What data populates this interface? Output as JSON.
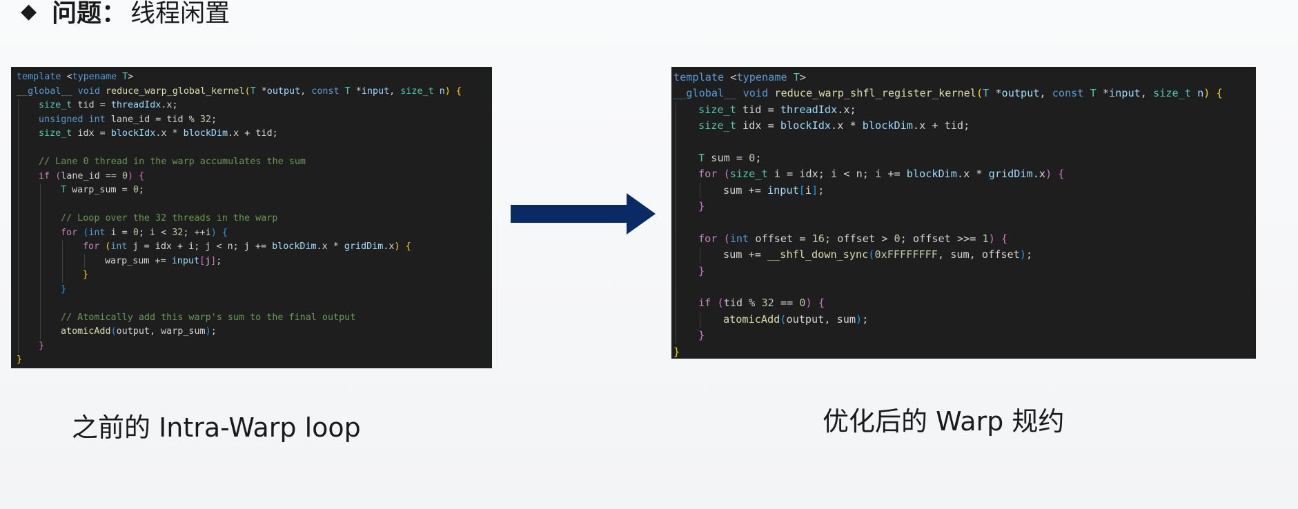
{
  "heading": {
    "bullet": "◆",
    "label": "问题：",
    "text": "线程闲置"
  },
  "colors": {
    "code_background": "#1e1e1e",
    "arrow": "#0a2a66",
    "keyword": "#569cd6",
    "control": "#c586c0",
    "type": "#4ec9b0",
    "function": "#dcdcaa",
    "variable": "#9cdcfe",
    "number": "#b5cea8",
    "comment": "#6a9955"
  },
  "code_left": {
    "lines": [
      {
        "indent": 0,
        "tokens": [
          [
            "kw",
            "template"
          ],
          [
            "plain",
            " <"
          ],
          [
            "kw",
            "typename"
          ],
          [
            "plain",
            " "
          ],
          [
            "ty",
            "T"
          ],
          [
            "plain",
            ">"
          ]
        ]
      },
      {
        "indent": 0,
        "tokens": [
          [
            "kw",
            "__global__"
          ],
          [
            "plain",
            " "
          ],
          [
            "kw",
            "void"
          ],
          [
            "plain",
            " "
          ],
          [
            "fn",
            "reduce_warp_global_kernel"
          ],
          [
            "br1",
            "("
          ],
          [
            "ty",
            "T"
          ],
          [
            "plain",
            " *"
          ],
          [
            "var",
            "output"
          ],
          [
            "plain",
            ", "
          ],
          [
            "kw",
            "const"
          ],
          [
            "plain",
            " "
          ],
          [
            "ty",
            "T"
          ],
          [
            "plain",
            " *"
          ],
          [
            "var",
            "input"
          ],
          [
            "plain",
            ", "
          ],
          [
            "ty",
            "size_t"
          ],
          [
            "plain",
            " "
          ],
          [
            "var",
            "n"
          ],
          [
            "br1",
            ")"
          ],
          [
            "plain",
            " "
          ],
          [
            "br1",
            "{"
          ]
        ]
      },
      {
        "indent": 1,
        "tokens": [
          [
            "ty",
            "size_t"
          ],
          [
            "plain",
            " tid = "
          ],
          [
            "var",
            "threadIdx"
          ],
          [
            "plain",
            ".x;"
          ]
        ]
      },
      {
        "indent": 1,
        "tokens": [
          [
            "kw",
            "unsigned int"
          ],
          [
            "plain",
            " lane_id = tid % "
          ],
          [
            "num",
            "32"
          ],
          [
            "plain",
            ";"
          ]
        ]
      },
      {
        "indent": 1,
        "tokens": [
          [
            "ty",
            "size_t"
          ],
          [
            "plain",
            " idx = "
          ],
          [
            "var",
            "blockIdx"
          ],
          [
            "plain",
            ".x * "
          ],
          [
            "var",
            "blockDim"
          ],
          [
            "plain",
            ".x + tid;"
          ]
        ]
      },
      {
        "indent": 1,
        "tokens": []
      },
      {
        "indent": 1,
        "tokens": [
          [
            "cm",
            "// Lane 0 thread in the warp accumulates the sum"
          ]
        ]
      },
      {
        "indent": 1,
        "tokens": [
          [
            "ctl",
            "if"
          ],
          [
            "plain",
            " "
          ],
          [
            "br2",
            "("
          ],
          [
            "plain",
            "lane_id == "
          ],
          [
            "num",
            "0"
          ],
          [
            "br2",
            ")"
          ],
          [
            "plain",
            " "
          ],
          [
            "br2",
            "{"
          ]
        ]
      },
      {
        "indent": 2,
        "tokens": [
          [
            "ty",
            "T"
          ],
          [
            "plain",
            " warp_sum = "
          ],
          [
            "num",
            "0"
          ],
          [
            "plain",
            ";"
          ]
        ]
      },
      {
        "indent": 2,
        "tokens": []
      },
      {
        "indent": 2,
        "tokens": [
          [
            "cm",
            "// Loop over the 32 threads in the warp"
          ]
        ]
      },
      {
        "indent": 2,
        "tokens": [
          [
            "ctl",
            "for"
          ],
          [
            "plain",
            " "
          ],
          [
            "br3",
            "("
          ],
          [
            "kw",
            "int"
          ],
          [
            "plain",
            " i = "
          ],
          [
            "num",
            "0"
          ],
          [
            "plain",
            "; i < "
          ],
          [
            "num",
            "32"
          ],
          [
            "plain",
            "; ++i"
          ],
          [
            "br3",
            ")"
          ],
          [
            "plain",
            " "
          ],
          [
            "br3",
            "{"
          ]
        ]
      },
      {
        "indent": 3,
        "tokens": [
          [
            "ctl",
            "for"
          ],
          [
            "plain",
            " "
          ],
          [
            "br1",
            "("
          ],
          [
            "kw",
            "int"
          ],
          [
            "plain",
            " j = idx + i; j < n; j += "
          ],
          [
            "var",
            "blockDim"
          ],
          [
            "plain",
            ".x * "
          ],
          [
            "var",
            "gridDim"
          ],
          [
            "plain",
            ".x"
          ],
          [
            "br1",
            ")"
          ],
          [
            "plain",
            " "
          ],
          [
            "br1",
            "{"
          ]
        ]
      },
      {
        "indent": 4,
        "tokens": [
          [
            "plain",
            "warp_sum += "
          ],
          [
            "var",
            "input"
          ],
          [
            "br2",
            "["
          ],
          [
            "plain",
            "j"
          ],
          [
            "br2",
            "]"
          ],
          [
            "plain",
            ";"
          ]
        ]
      },
      {
        "indent": 3,
        "tokens": [
          [
            "br1",
            "}"
          ]
        ]
      },
      {
        "indent": 2,
        "tokens": [
          [
            "br3",
            "}"
          ]
        ]
      },
      {
        "indent": 2,
        "tokens": []
      },
      {
        "indent": 2,
        "tokens": [
          [
            "cm",
            "// Atomically add this warp's sum to the final output"
          ]
        ]
      },
      {
        "indent": 2,
        "tokens": [
          [
            "fn",
            "atomicAdd"
          ],
          [
            "br3",
            "("
          ],
          [
            "plain",
            "output, warp_sum"
          ],
          [
            "br3",
            ")"
          ],
          [
            "plain",
            ";"
          ]
        ]
      },
      {
        "indent": 1,
        "tokens": [
          [
            "br2",
            "}"
          ]
        ]
      },
      {
        "indent": 0,
        "tokens": [
          [
            "br1",
            "}"
          ]
        ]
      }
    ]
  },
  "code_right": {
    "lines": [
      {
        "indent": 0,
        "tokens": [
          [
            "kw",
            "template"
          ],
          [
            "plain",
            " <"
          ],
          [
            "kw",
            "typename"
          ],
          [
            "plain",
            " "
          ],
          [
            "ty",
            "T"
          ],
          [
            "plain",
            ">"
          ]
        ]
      },
      {
        "indent": 0,
        "tokens": [
          [
            "kw",
            "__global__"
          ],
          [
            "plain",
            " "
          ],
          [
            "kw",
            "void"
          ],
          [
            "plain",
            " "
          ],
          [
            "fn",
            "reduce_warp_shfl_register_kernel"
          ],
          [
            "br1",
            "("
          ],
          [
            "ty",
            "T"
          ],
          [
            "plain",
            " *"
          ],
          [
            "var",
            "output"
          ],
          [
            "plain",
            ", "
          ],
          [
            "kw",
            "const"
          ],
          [
            "plain",
            " "
          ],
          [
            "ty",
            "T"
          ],
          [
            "plain",
            " *"
          ],
          [
            "var",
            "input"
          ],
          [
            "plain",
            ", "
          ],
          [
            "ty",
            "size_t"
          ],
          [
            "plain",
            " "
          ],
          [
            "var",
            "n"
          ],
          [
            "br1",
            ")"
          ],
          [
            "plain",
            " "
          ],
          [
            "br1",
            "{"
          ]
        ]
      },
      {
        "indent": 1,
        "tokens": [
          [
            "ty",
            "size_t"
          ],
          [
            "plain",
            " tid = "
          ],
          [
            "var",
            "threadIdx"
          ],
          [
            "plain",
            ".x;"
          ]
        ]
      },
      {
        "indent": 1,
        "tokens": [
          [
            "ty",
            "size_t"
          ],
          [
            "plain",
            " idx = "
          ],
          [
            "var",
            "blockIdx"
          ],
          [
            "plain",
            ".x * "
          ],
          [
            "var",
            "blockDim"
          ],
          [
            "plain",
            ".x + tid;"
          ]
        ]
      },
      {
        "indent": 1,
        "tokens": []
      },
      {
        "indent": 1,
        "tokens": [
          [
            "ty",
            "T"
          ],
          [
            "plain",
            " sum = "
          ],
          [
            "num",
            "0"
          ],
          [
            "plain",
            ";"
          ]
        ]
      },
      {
        "indent": 1,
        "tokens": [
          [
            "ctl",
            "for"
          ],
          [
            "plain",
            " "
          ],
          [
            "br2",
            "("
          ],
          [
            "ty",
            "size_t"
          ],
          [
            "plain",
            " i = idx; i < n; i += "
          ],
          [
            "var",
            "blockDim"
          ],
          [
            "plain",
            ".x * "
          ],
          [
            "var",
            "gridDim"
          ],
          [
            "plain",
            ".x"
          ],
          [
            "br2",
            ")"
          ],
          [
            "plain",
            " "
          ],
          [
            "br2",
            "{"
          ]
        ]
      },
      {
        "indent": 2,
        "tokens": [
          [
            "plain",
            "sum += "
          ],
          [
            "var",
            "input"
          ],
          [
            "br3",
            "["
          ],
          [
            "plain",
            "i"
          ],
          [
            "br3",
            "]"
          ],
          [
            "plain",
            ";"
          ]
        ]
      },
      {
        "indent": 1,
        "tokens": [
          [
            "br2",
            "}"
          ]
        ]
      },
      {
        "indent": 1,
        "tokens": []
      },
      {
        "indent": 1,
        "tokens": [
          [
            "ctl",
            "for"
          ],
          [
            "plain",
            " "
          ],
          [
            "br2",
            "("
          ],
          [
            "kw",
            "int"
          ],
          [
            "plain",
            " offset = "
          ],
          [
            "num",
            "16"
          ],
          [
            "plain",
            "; offset > "
          ],
          [
            "num",
            "0"
          ],
          [
            "plain",
            "; offset >>= "
          ],
          [
            "num",
            "1"
          ],
          [
            "br2",
            ")"
          ],
          [
            "plain",
            " "
          ],
          [
            "br2",
            "{"
          ]
        ]
      },
      {
        "indent": 2,
        "tokens": [
          [
            "plain",
            "sum += "
          ],
          [
            "fn",
            "__shfl_down_sync"
          ],
          [
            "br3",
            "("
          ],
          [
            "num",
            "0xFFFFFFFF"
          ],
          [
            "plain",
            ", sum, offset"
          ],
          [
            "br3",
            ")"
          ],
          [
            "plain",
            ";"
          ]
        ]
      },
      {
        "indent": 1,
        "tokens": [
          [
            "br2",
            "}"
          ]
        ]
      },
      {
        "indent": 1,
        "tokens": []
      },
      {
        "indent": 1,
        "tokens": [
          [
            "ctl",
            "if"
          ],
          [
            "plain",
            " "
          ],
          [
            "br2",
            "("
          ],
          [
            "plain",
            "tid % "
          ],
          [
            "num",
            "32"
          ],
          [
            "plain",
            " == "
          ],
          [
            "num",
            "0"
          ],
          [
            "br2",
            ")"
          ],
          [
            "plain",
            " "
          ],
          [
            "br2",
            "{"
          ]
        ]
      },
      {
        "indent": 2,
        "tokens": [
          [
            "fn",
            "atomicAdd"
          ],
          [
            "br3",
            "("
          ],
          [
            "plain",
            "output, sum"
          ],
          [
            "br3",
            ")"
          ],
          [
            "plain",
            ";"
          ]
        ]
      },
      {
        "indent": 1,
        "tokens": [
          [
            "br2",
            "}"
          ]
        ]
      },
      {
        "indent": 0,
        "tokens": [
          [
            "br1",
            "}"
          ]
        ]
      }
    ]
  },
  "captions": {
    "left": "之前的 Intra-Warp loop",
    "right": "优化后的 Warp 规约"
  }
}
